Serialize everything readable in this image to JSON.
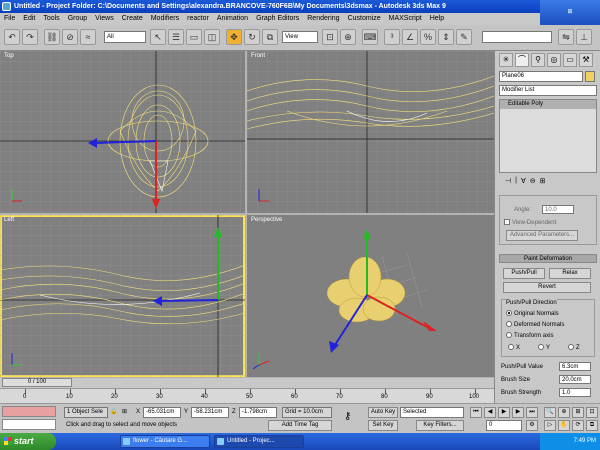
{
  "window": {
    "title": "Untitled    - Project Folder: C:\\Documents and Settings\\alexandra.BRANCOVE-760F6B\\My Documents\\3dsmax    - Autodesk 3ds Max 9"
  },
  "menu": [
    "File",
    "Edit",
    "Tools",
    "Group",
    "Views",
    "Create",
    "Modifiers",
    "reactor",
    "Animation",
    "Graph Editors",
    "Rendering",
    "Customize",
    "MAXScript",
    "Help"
  ],
  "toolbar": {
    "selection_filter": "All",
    "ref_coord": "View"
  },
  "viewports": {
    "top": "Top",
    "front": "Front",
    "left": "Left",
    "perspective": "Perspective"
  },
  "command_panel": {
    "object_name": "Plane06",
    "object_color": "#f0d060",
    "modifier_list": "Modifier List",
    "stack_item": "Editable Poly",
    "angle_label": "Angle:",
    "angle_value": "10.0",
    "view_dependent": "View-Dependent",
    "advanced_params": "Advanced Parameters...",
    "rollout_paint": "Paint Deformation",
    "push_pull": "Push/Pull",
    "relax": "Relax",
    "revert": "Revert",
    "direction_group": "Push/Pull Direction",
    "original_normals": "Original Normals",
    "deformed_normals": "Deformed Normals",
    "transform_axis": "Transform axis",
    "axis_x": "X",
    "axis_y": "Y",
    "axis_z": "Z",
    "push_pull_value_label": "Push/Pull Value",
    "push_pull_value": "6.3cm",
    "brush_size_label": "Brush Size",
    "brush_size": "20.0cm",
    "brush_strength_label": "Brush Strength",
    "brush_strength": "1.0"
  },
  "timeline": {
    "frame": "0 / 100",
    "ticks": [
      "0",
      "10",
      "20",
      "30",
      "40",
      "50",
      "60",
      "70",
      "80",
      "90",
      "100"
    ]
  },
  "status": {
    "selection": "1 Object Sele",
    "x_label": "X",
    "x": "-65.031cm",
    "y_label": "Y",
    "y": "-58.231cm",
    "z_label": "Z",
    "z": "-1.798cm",
    "grid": "Grid = 10.0cm",
    "auto_key": "Auto Key",
    "key_mode": "Selected",
    "set_key": "Set Key",
    "key_filters": "Key Filters...",
    "prompt": "Click and drag to select and move objects",
    "add_time_tag": "Add Time Tag",
    "frame_value": "0"
  },
  "taskbar": {
    "start": "start",
    "tasks": [
      "flower - Căutare G...",
      "Untitled    - Projec..."
    ],
    "clock": "7:49 PM"
  }
}
